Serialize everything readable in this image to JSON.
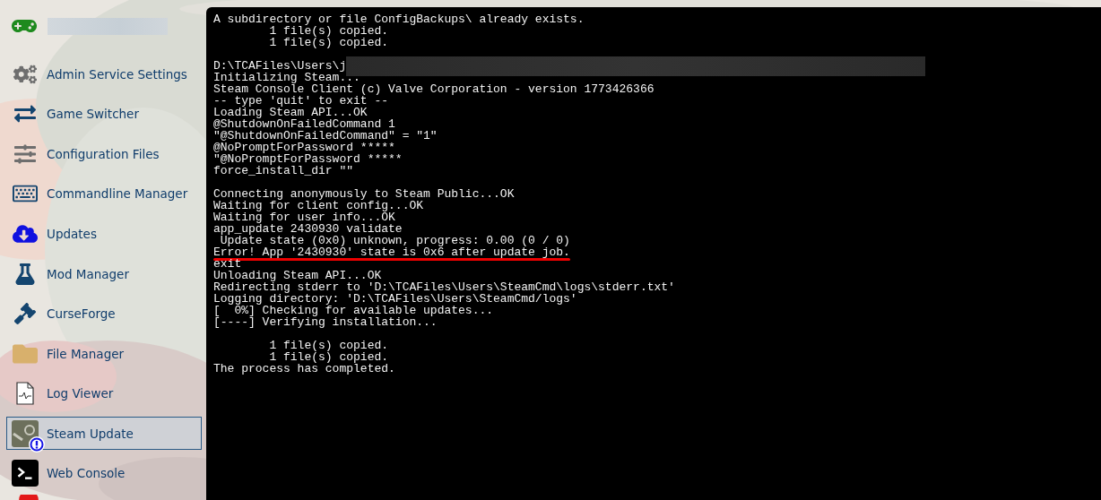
{
  "sidebar": {
    "header": {
      "name_redacted": true
    },
    "items": [
      {
        "label": "Admin Service Settings",
        "selected": false,
        "alert": false
      },
      {
        "label": "Game Switcher",
        "selected": false,
        "alert": false
      },
      {
        "label": "Configuration Files",
        "selected": false,
        "alert": false
      },
      {
        "label": "Commandline Manager",
        "selected": false,
        "alert": false
      },
      {
        "label": "Updates",
        "selected": false,
        "alert": false
      },
      {
        "label": "Mod Manager",
        "selected": false,
        "alert": false
      },
      {
        "label": "CurseForge",
        "selected": false,
        "alert": false
      },
      {
        "label": "File Manager",
        "selected": false,
        "alert": false
      },
      {
        "label": "Log Viewer",
        "selected": false,
        "alert": false
      },
      {
        "label": "Steam Update",
        "selected": true,
        "alert": true
      },
      {
        "label": "Web Console",
        "selected": false,
        "alert": false
      }
    ]
  },
  "console": {
    "lines": [
      {
        "text": "A subdirectory or file ConfigBackups\\ already exists."
      },
      {
        "text": "        1 file(s) copied."
      },
      {
        "text": "        1 file(s) copied."
      },
      {
        "text": "D:\\TCAFiles\\Users\\j",
        "redacted": true,
        "space_before": true
      },
      {
        "text": "Initializing Steam..."
      },
      {
        "text": "Steam Console Client (c) Valve Corporation - version 1773426366"
      },
      {
        "text": "-- type 'quit' to exit --"
      },
      {
        "text": "Loading Steam API...OK"
      },
      {
        "text": "@ShutdownOnFailedCommand 1"
      },
      {
        "text": "\"@ShutdownOnFailedCommand\" = \"1\""
      },
      {
        "text": "@NoPromptForPassword *****"
      },
      {
        "text": "\"@NoPromptForPassword *****"
      },
      {
        "text": "force_install_dir \"\""
      },
      {
        "text": "Connecting anonymously to Steam Public...OK",
        "space_before": true
      },
      {
        "text": "Waiting for client config...OK"
      },
      {
        "text": "Waiting for user info...OK"
      },
      {
        "text": "app_update 2430930 validate"
      },
      {
        "text": " Update state (0x0) unknown, progress: 0.00 (0 / 0)"
      },
      {
        "text": "Error! App '2430930' state is 0x6 after update job.",
        "underlined": true
      },
      {
        "text": "exit"
      },
      {
        "text": "Unloading Steam API...OK"
      },
      {
        "text": "Redirecting stderr to 'D:\\TCAFiles\\Users\\SteamCmd\\logs\\stderr.txt'"
      },
      {
        "text": "Logging directory: 'D:\\TCAFiles\\Users\\SteamCmd/logs'"
      },
      {
        "text": "[  0%] Checking for available updates..."
      },
      {
        "text": "[----] Verifying installation..."
      },
      {
        "text": "        1 file(s) copied.",
        "space_before": true
      },
      {
        "text": "        1 file(s) copied."
      },
      {
        "text": "The process has completed."
      }
    ]
  }
}
